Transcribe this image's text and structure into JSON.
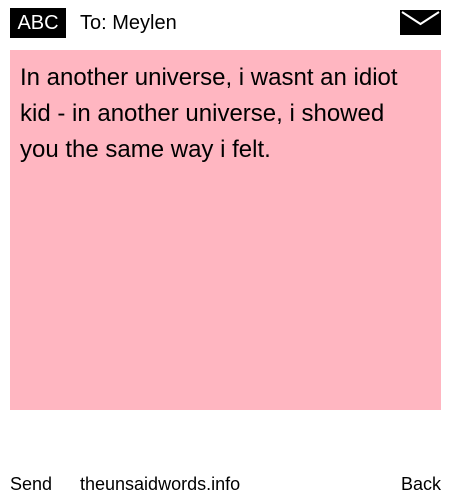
{
  "header": {
    "badge_text": "ABC",
    "to_label": "To: Meylen",
    "envelope_icon": "envelope-icon"
  },
  "note": {
    "message": "In another universe, i wasnt an idiot kid - in another universe, i showed you the same way i felt.",
    "background_color": "#ffb6c1"
  },
  "footer": {
    "send_label": "Send",
    "site_label": "theunsaidwords.info",
    "back_label": "Back"
  }
}
